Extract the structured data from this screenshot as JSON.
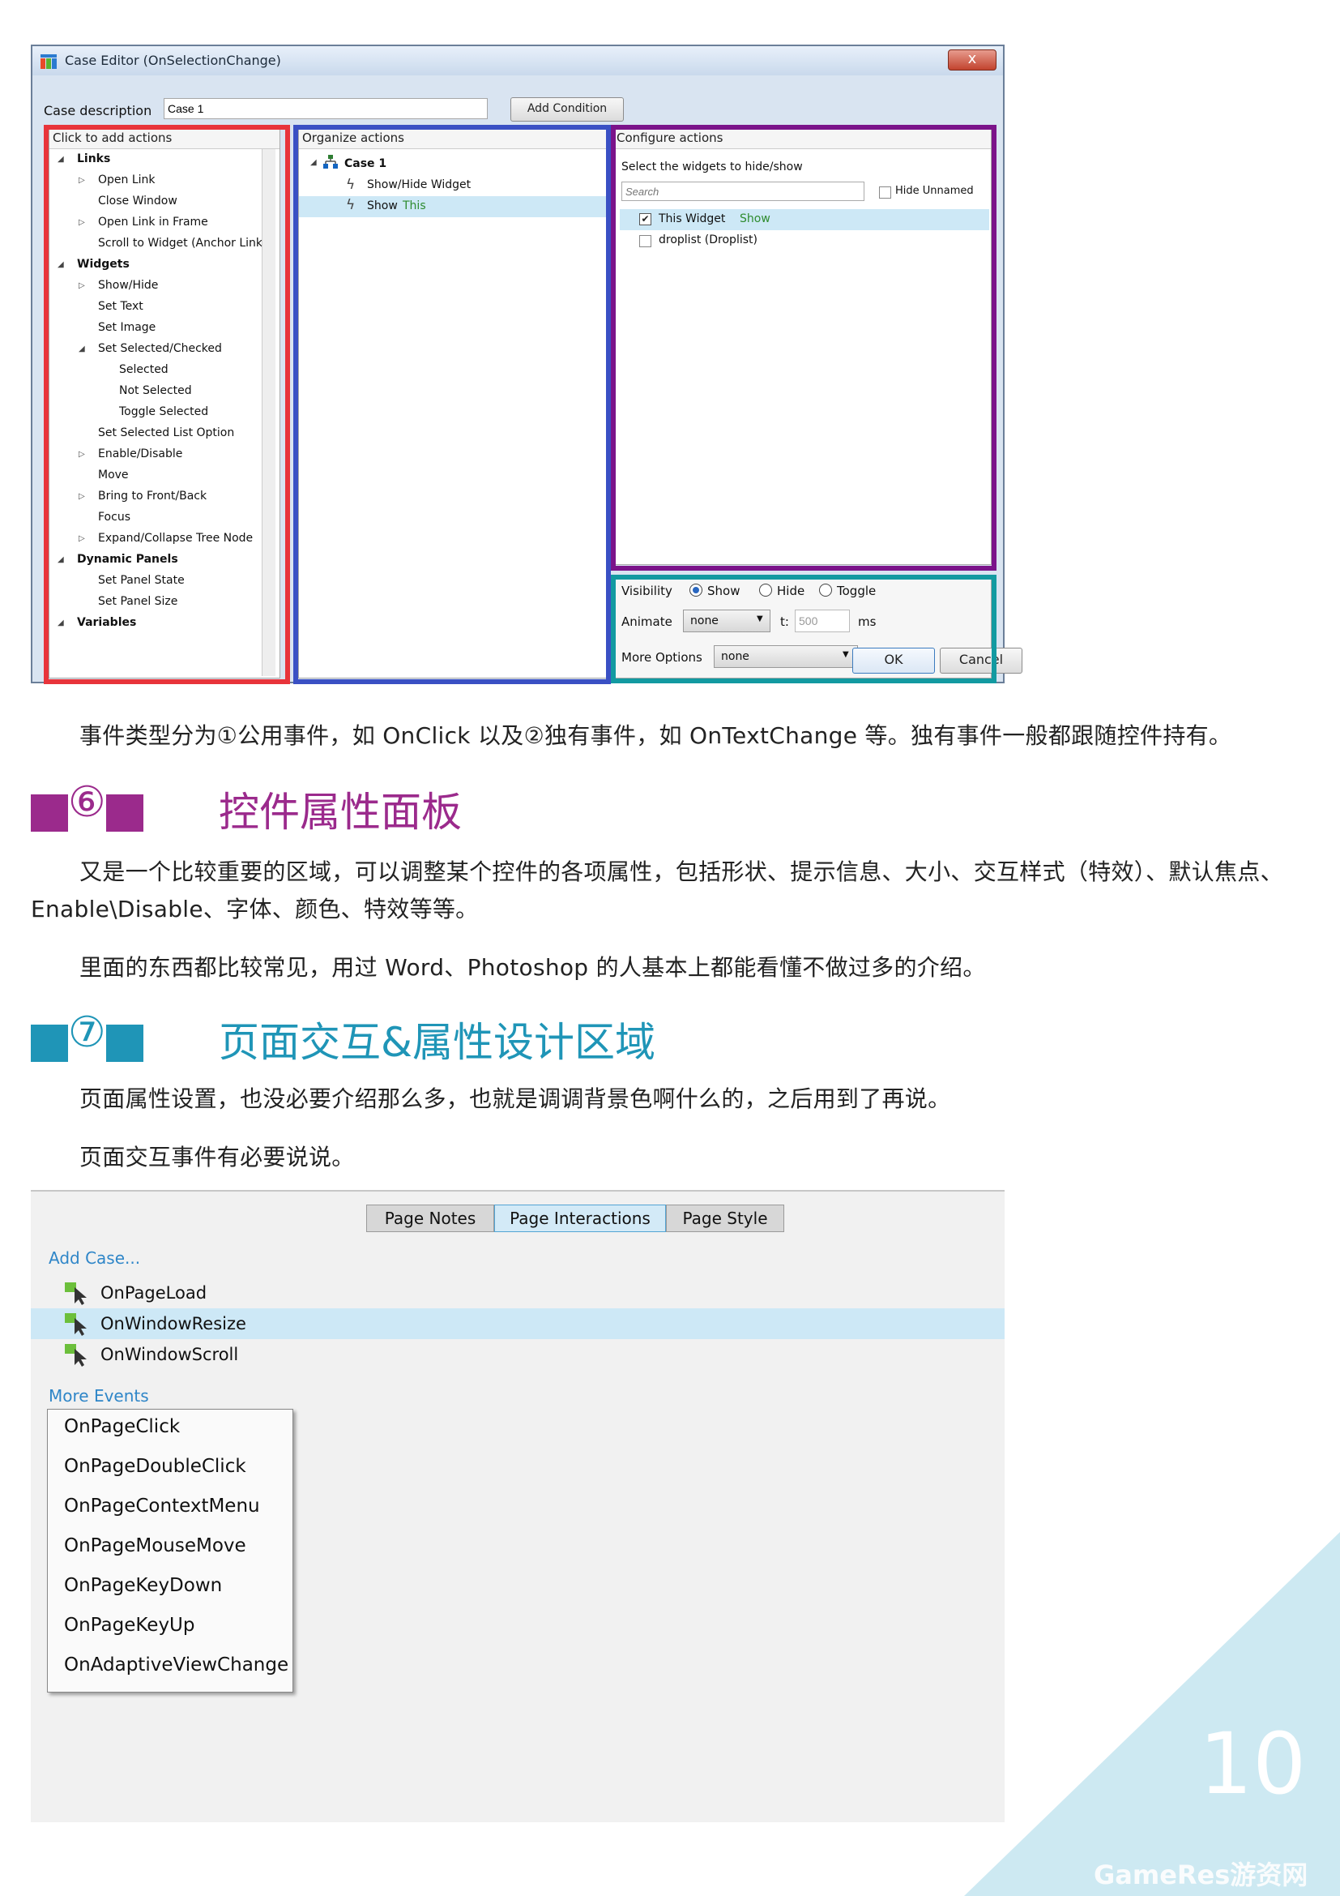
{
  "case_editor": {
    "window_title": "Case Editor (OnSelectionChange)",
    "close_glyph": "x",
    "case_description_label": "Case description",
    "case_description_value": "Case 1",
    "add_condition_label": "Add Condition",
    "actions_panel": {
      "header": "Click to add actions",
      "items": [
        {
          "label": "Links",
          "bold": true,
          "depth": 0,
          "toggle": "open"
        },
        {
          "label": "Open Link",
          "bold": false,
          "depth": 1,
          "toggle": "closed"
        },
        {
          "label": "Close Window",
          "bold": false,
          "depth": 1,
          "toggle": "none"
        },
        {
          "label": "Open Link in Frame",
          "bold": false,
          "depth": 1,
          "toggle": "closed"
        },
        {
          "label": "Scroll to Widget (Anchor Link)",
          "bold": false,
          "depth": 1,
          "toggle": "none"
        },
        {
          "label": "Widgets",
          "bold": true,
          "depth": 0,
          "toggle": "open"
        },
        {
          "label": "Show/Hide",
          "bold": false,
          "depth": 1,
          "toggle": "closed"
        },
        {
          "label": "Set Text",
          "bold": false,
          "depth": 1,
          "toggle": "none"
        },
        {
          "label": "Set Image",
          "bold": false,
          "depth": 1,
          "toggle": "none"
        },
        {
          "label": "Set Selected/Checked",
          "bold": false,
          "depth": 1,
          "toggle": "open"
        },
        {
          "label": "Selected",
          "bold": false,
          "depth": 2,
          "toggle": "none"
        },
        {
          "label": "Not Selected",
          "bold": false,
          "depth": 2,
          "toggle": "none"
        },
        {
          "label": "Toggle Selected",
          "bold": false,
          "depth": 2,
          "toggle": "none"
        },
        {
          "label": "Set Selected List Option",
          "bold": false,
          "depth": 1,
          "toggle": "none"
        },
        {
          "label": "Enable/Disable",
          "bold": false,
          "depth": 1,
          "toggle": "closed"
        },
        {
          "label": "Move",
          "bold": false,
          "depth": 1,
          "toggle": "none"
        },
        {
          "label": "Bring to Front/Back",
          "bold": false,
          "depth": 1,
          "toggle": "closed"
        },
        {
          "label": "Focus",
          "bold": false,
          "depth": 1,
          "toggle": "none"
        },
        {
          "label": "Expand/Collapse Tree Node",
          "bold": false,
          "depth": 1,
          "toggle": "closed"
        },
        {
          "label": "Dynamic Panels",
          "bold": true,
          "depth": 0,
          "toggle": "open"
        },
        {
          "label": "Set Panel State",
          "bold": false,
          "depth": 1,
          "toggle": "none"
        },
        {
          "label": "Set Panel Size",
          "bold": false,
          "depth": 1,
          "toggle": "none"
        },
        {
          "label": "Variables",
          "bold": true,
          "depth": 0,
          "toggle": "open"
        }
      ]
    },
    "organize_panel": {
      "header": "Organize actions",
      "case_label": "Case 1",
      "action_1": "Show/Hide Widget",
      "action_2_prefix": "Show",
      "action_2_target": "This"
    },
    "configure_panel": {
      "header": "Configure actions",
      "instruction": "Select the widgets to hide/show",
      "search_placeholder": "Search",
      "hide_unnamed_label": "Hide Unnamed",
      "widget_1_label": "This Widget",
      "widget_1_state": "Show",
      "widget_2_label": "droplist (Droplist)"
    },
    "visibility": {
      "label": "Visibility",
      "show": "Show",
      "hide": "Hide",
      "toggle": "Toggle",
      "animate_label": "Animate",
      "animate_value": "none",
      "t_label": "t:",
      "t_value": "500",
      "ms_label": "ms",
      "more_options_label": "More Options",
      "more_options_value": "none"
    },
    "ok_label": "OK",
    "cancel_label": "Cancel"
  },
  "text": {
    "para_events": "事件类型分为①公用事件，如 OnClick 以及②独有事件，如 OnTextChange 等。独有事件一般都跟随控件持有。",
    "section6_num": "⑥",
    "section6_title": "控件属性面板",
    "section6_para1_line1": "又是一个比较重要的区域，可以调整某个控件的各项属性，包括形状、提示信息、大小、交互样式（特效）、默认焦点、",
    "section6_para1_line2": "Enable\\Disable、字体、颜色、特效等等。",
    "section6_para2": "里面的东西都比较常见，用过 Word、Photoshop 的人基本上都能看懂不做过多的介绍。",
    "section7_num": "⑦",
    "section7_title": "页面交互&属性设计区域",
    "section7_para1": "页面属性设置，也没必要介绍那么多，也就是调调背景色啊什么的，之后用到了再说。",
    "section7_para2": "页面交互事件有必要说说。"
  },
  "page_panel": {
    "tabs": [
      "Page Notes",
      "Page Interactions",
      "Page Style"
    ],
    "active_tab": "Page Interactions",
    "add_case": "Add Case...",
    "events": [
      "OnPageLoad",
      "OnWindowResize",
      "OnWindowScroll"
    ],
    "selected_event": "OnWindowResize",
    "more_events": "More Events",
    "menu_items": [
      "OnPageClick",
      "OnPageDoubleClick",
      "OnPageContextMenu",
      "OnPageMouseMove",
      "OnPageKeyDown",
      "OnPageKeyUp",
      "OnAdaptiveViewChange"
    ]
  },
  "footer": {
    "page_number": "10",
    "watermark": "GameRes游资网"
  },
  "colors": {
    "section6_accent": "#9b2a8c",
    "section7_accent": "#1f95b7",
    "corner_triangle": "#cde9f2",
    "highlight_red": "#e8343b",
    "highlight_blue": "#3a50c4",
    "highlight_purple": "#7b138a",
    "highlight_teal": "#129aa1",
    "link_blue": "#2f86c8"
  }
}
